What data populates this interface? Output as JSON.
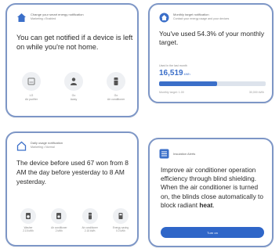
{
  "cards": {
    "presence": {
      "app_title": "Change your smart energy notification",
      "app_subtitle": "Marketing • Enabled",
      "message": "You can get notified if a device is left on while you're not home.",
      "devices": [
        {
          "icon": "air-conditioner-icon",
          "label": "LG",
          "sublabel": "Air purifier"
        },
        {
          "icon": "person-icon",
          "label": "Go",
          "sublabel": "Away"
        },
        {
          "icon": "refrigerator-icon",
          "label": "Go",
          "sublabel": "Air conditioner"
        }
      ]
    },
    "target": {
      "app_title": "Monthly target notification",
      "app_subtitle": "Contact your energy usage and your devices",
      "message": "You've used 54.3% of your monthly target.",
      "label": "Used in the last month",
      "value": "16,519",
      "unit": "kWh",
      "progress": 0.543,
      "footer_left": "Monthly target: 1.00",
      "footer_right": "30,000 kWh"
    },
    "usage": {
      "app_title": "Daily usage notification",
      "app_subtitle": "Marketing • Normal",
      "message": "The device before used 67 won from 8 AM the day before yesterday to 8 AM yesterday.",
      "devices": [
        {
          "icon": "washer-icon",
          "label": "Washer",
          "value": "2.15 kWh"
        },
        {
          "icon": "dryer-icon",
          "label": "Air conditioner",
          "value": "2 kWh"
        },
        {
          "icon": "refrigerator-icon",
          "label": "Air conditioner",
          "value": "2.15 kWh"
        },
        {
          "icon": "tv-icon",
          "label": "Energy saving",
          "value": "0.0 kWh"
        }
      ]
    },
    "tip": {
      "app_title": "Insulation Alerts",
      "message_before": "Improve air conditioner operation efficiency through blind shielding. When the air conditioner is turned on, the blinds close automatically to block radiant ",
      "message_bold": "heat",
      "message_after": ".",
      "button_label": "Turn on"
    }
  },
  "colors": {
    "card_border": "#7d96c6",
    "accent": "#2f66c8",
    "progress_track": "#dde3ec"
  }
}
